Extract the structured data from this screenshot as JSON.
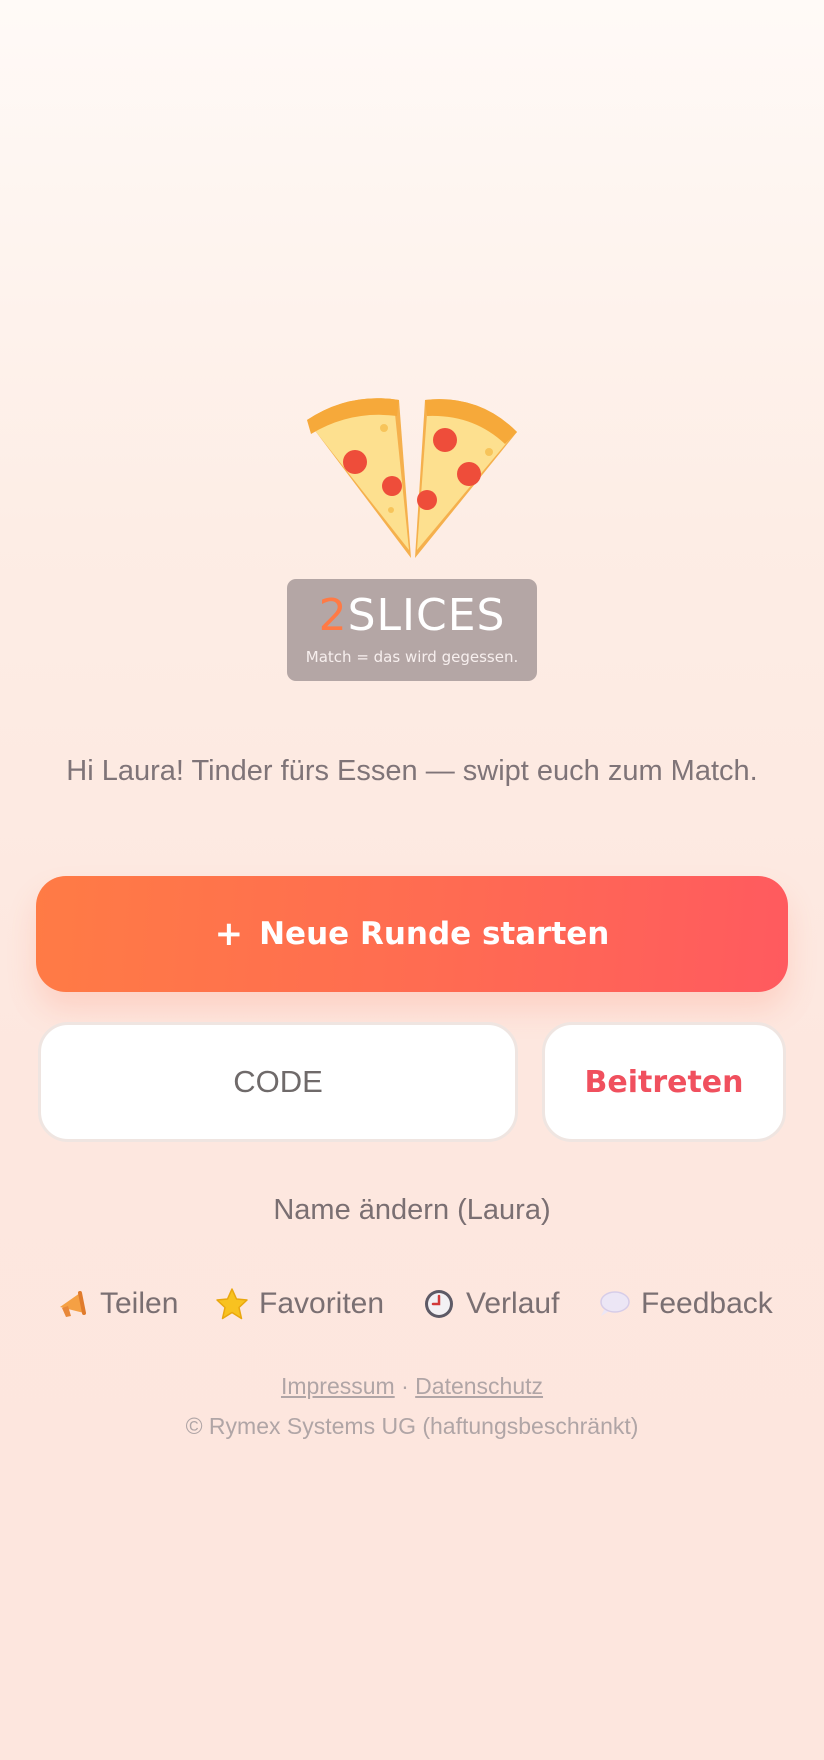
{
  "brand": {
    "name_digit": "2",
    "name_word": "SLICES",
    "tagline": "Match = das wird gegessen.",
    "logo_icon": "pizza-slices-icon",
    "colors": {
      "accent": "#ff7a45",
      "box": "#b4a6a5"
    }
  },
  "greeting": "Hi Laura! Tinder fürs Essen — swipt euch zum Match.",
  "primary_action": {
    "icon": "plus-icon",
    "icon_glyph": "+",
    "label": "Neue Runde starten",
    "colors": {
      "from": "#ff7b45",
      "to": "#ff5a5f"
    }
  },
  "join": {
    "code_placeholder": "CODE",
    "code_value": "",
    "button_label": "Beitreten",
    "button_color": "#f0505e"
  },
  "change_name_label": "Name ändern (Laura)",
  "actions": [
    {
      "icon": "megaphone-icon",
      "label": "Teilen"
    },
    {
      "icon": "star-icon",
      "label": "Favoriten"
    },
    {
      "icon": "clock-icon",
      "label": "Verlauf"
    },
    {
      "icon": "speech-bubble-icon",
      "label": "Feedback"
    }
  ],
  "footer": {
    "impressum": "Impressum",
    "separator": "·",
    "datenschutz": "Datenschutz",
    "copyright": "© Rymex Systems UG (haftungsbeschränkt)"
  }
}
